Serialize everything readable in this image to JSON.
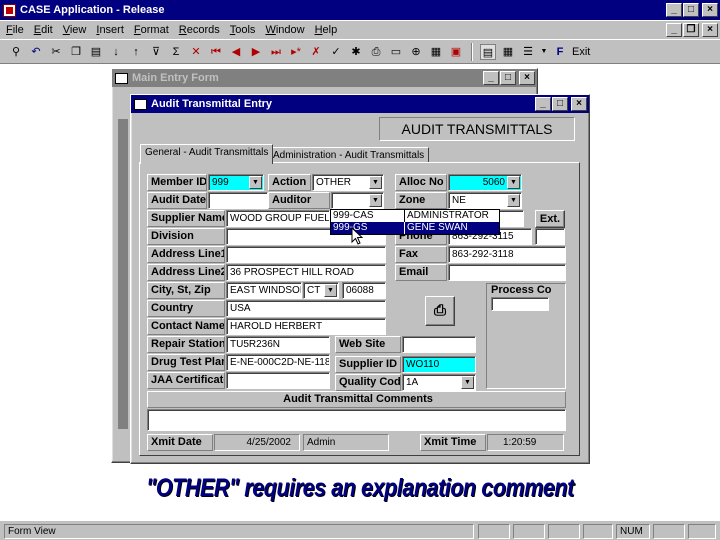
{
  "app": {
    "title": "CASE Application - Release",
    "menu": [
      "File",
      "Edit",
      "View",
      "Insert",
      "Format",
      "Records",
      "Tools",
      "Window",
      "Help"
    ],
    "toolbar_exit_label": "Exit"
  },
  "main_form": {
    "title": "Main Entry Form"
  },
  "audit_window": {
    "title": "Audit Transmittal Entry",
    "header": "AUDIT TRANSMITTALS",
    "tabs": [
      "General - Audit Transmittals",
      "Administration - Audit Transmittals"
    ]
  },
  "fields": {
    "member_id": {
      "label": "Member ID",
      "value": "999"
    },
    "action": {
      "label": "Action",
      "value": "OTHER"
    },
    "alloc_no": {
      "label": "Alloc No",
      "value": "5060"
    },
    "audit_date": {
      "label": "Audit Date",
      "value": ""
    },
    "auditor": {
      "label": "Auditor",
      "value": ""
    },
    "zone": {
      "label": "Zone",
      "value": "NE"
    },
    "supplier_name": {
      "label": "Supplier Name",
      "value": "WOOD GROUP FUEL"
    },
    "ext_button": "Ext.",
    "division": {
      "label": "Division",
      "value": ""
    },
    "phone": {
      "label": "Phone",
      "value": "863-292-3115"
    },
    "address_line1": {
      "label": "Address Line1",
      "value": ""
    },
    "fax": {
      "label": "Fax",
      "value": "863-292-3118"
    },
    "address_line2": {
      "label": "Address Line2",
      "value": "36 PROSPECT HILL ROAD"
    },
    "email": {
      "label": "Email",
      "value": ""
    },
    "city_st_zip": {
      "label": "City, St, Zip",
      "city": "EAST WINDSOR",
      "state": "CT",
      "zip": "06088"
    },
    "process_co": {
      "label": "Process Co",
      "value": ""
    },
    "country": {
      "label": "Country",
      "value": "USA"
    },
    "contact_name": {
      "label": "Contact Name",
      "value": "HAROLD HERBERT"
    },
    "repair_station": {
      "label": "Repair Station",
      "value": "TU5R236N"
    },
    "web_site": {
      "label": "Web Site",
      "value": ""
    },
    "drug_test_plan": {
      "label": "Drug Test Plan",
      "value": "E-NE-000C2D-NE-118"
    },
    "supplier_id": {
      "label": "Supplier ID",
      "value": "WO110"
    },
    "jaa_certificate": {
      "label": "JAA Certificate",
      "value": ""
    },
    "quality_code": {
      "label": "Quality Code",
      "value": "1A"
    },
    "comments": {
      "label": "Audit Transmittal Comments",
      "value": ""
    },
    "xmit_date": {
      "label": "Xmit Date",
      "value": "4/25/2002"
    },
    "xmit_user": {
      "value": "Admin"
    },
    "xmit_time": {
      "label": "Xmit Time",
      "value": "1:20:59"
    }
  },
  "auditor_dropdown": {
    "rows": [
      {
        "code": "999-CAS",
        "name": "ADMINISTRATOR"
      },
      {
        "code": "999-GS",
        "name": "GENE SWAN"
      }
    ]
  },
  "status": {
    "left": "Form View",
    "num": "NUM"
  },
  "caption": "\"OTHER\" requires an explanation comment"
}
